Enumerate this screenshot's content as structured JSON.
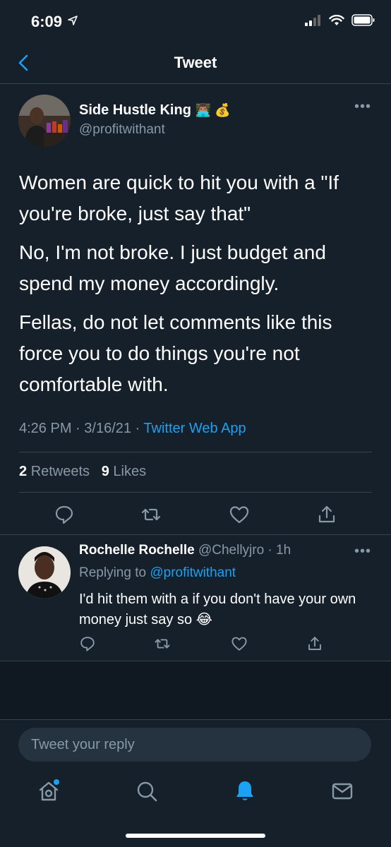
{
  "status_bar": {
    "time": "6:09"
  },
  "nav": {
    "title": "Tweet"
  },
  "main_tweet": {
    "display_name": "Side Hustle King",
    "name_emojis": "👨🏽‍💻 💰",
    "handle": "@profitwithant",
    "paragraphs": [
      "Women are quick to hit you with a \"If you're broke, just say that\"",
      "No, I'm not broke. I just budget and spend my money accordingly.",
      "Fellas, do not let comments like this force you to do things you're not comfortable with."
    ],
    "time": "4:26 PM",
    "date": "3/16/21",
    "source": "Twitter Web App",
    "retweets_count": "2",
    "retweets_label": "Retweets",
    "likes_count": "9",
    "likes_label": "Likes"
  },
  "reply": {
    "display_name": "Rochelle Rochelle",
    "handle": "@Chellyjro",
    "age": "1h",
    "replying_label": "Replying to",
    "replying_to": "@profitwithant",
    "text": "I'd hit them with a if you don't have your own money just say so 😂"
  },
  "compose": {
    "placeholder": "Tweet your reply"
  },
  "colors": {
    "background": "#15202b",
    "accent": "#1da1f2",
    "muted": "#8899a6",
    "divider": "#38444d"
  }
}
